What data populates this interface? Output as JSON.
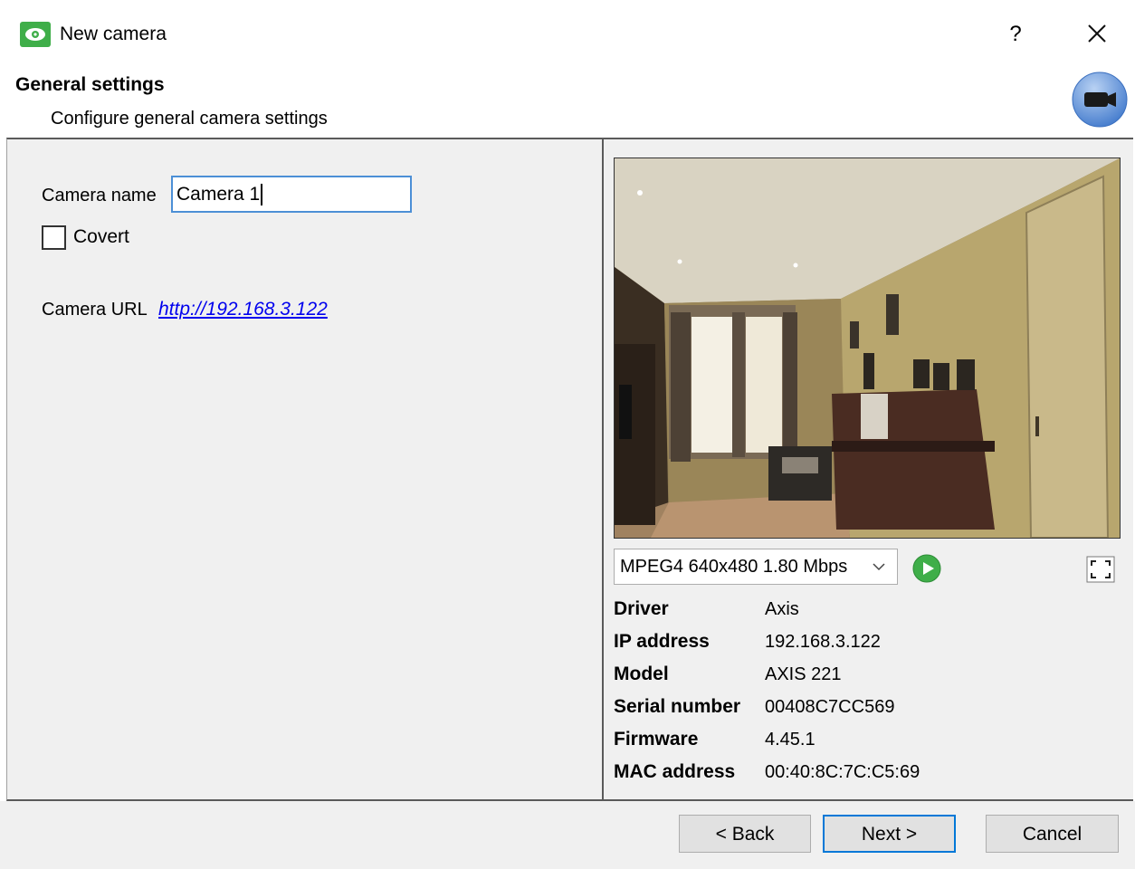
{
  "window": {
    "title": "New camera",
    "help": "?"
  },
  "header": {
    "title": "General settings",
    "subtitle": "Configure general camera settings"
  },
  "form": {
    "camera_name_label": "Camera name",
    "camera_name_value": "Camera 1",
    "covert_label": "Covert",
    "covert_checked": false,
    "camera_url_label": "Camera URL",
    "camera_url": "http://192.168.3.122"
  },
  "stream": {
    "selected": "MPEG4 640x480 1.80 Mbps"
  },
  "info": [
    {
      "key": "Driver",
      "value": "Axis"
    },
    {
      "key": "IP address",
      "value": "192.168.3.122"
    },
    {
      "key": "Model",
      "value": "AXIS 221"
    },
    {
      "key": "Serial number",
      "value": "00408C7CC569"
    },
    {
      "key": "Firmware",
      "value": "4.45.1"
    },
    {
      "key": "MAC address",
      "value": "00:40:8C:7C:C5:69"
    }
  ],
  "footer": {
    "back": "< Back",
    "next": "Next >",
    "cancel": "Cancel"
  },
  "icons": {
    "app": "eye-icon",
    "header": "camera-icon",
    "play": "play-icon",
    "fullscreen": "fullscreen-icon",
    "close": "close-icon",
    "dropdown": "chevron-down-icon"
  },
  "colors": {
    "accent": "#0078d7",
    "link": "#0000ee",
    "app_icon": "#3fae49",
    "play": "#3fae49",
    "header_icon": "#5b8fd8"
  }
}
